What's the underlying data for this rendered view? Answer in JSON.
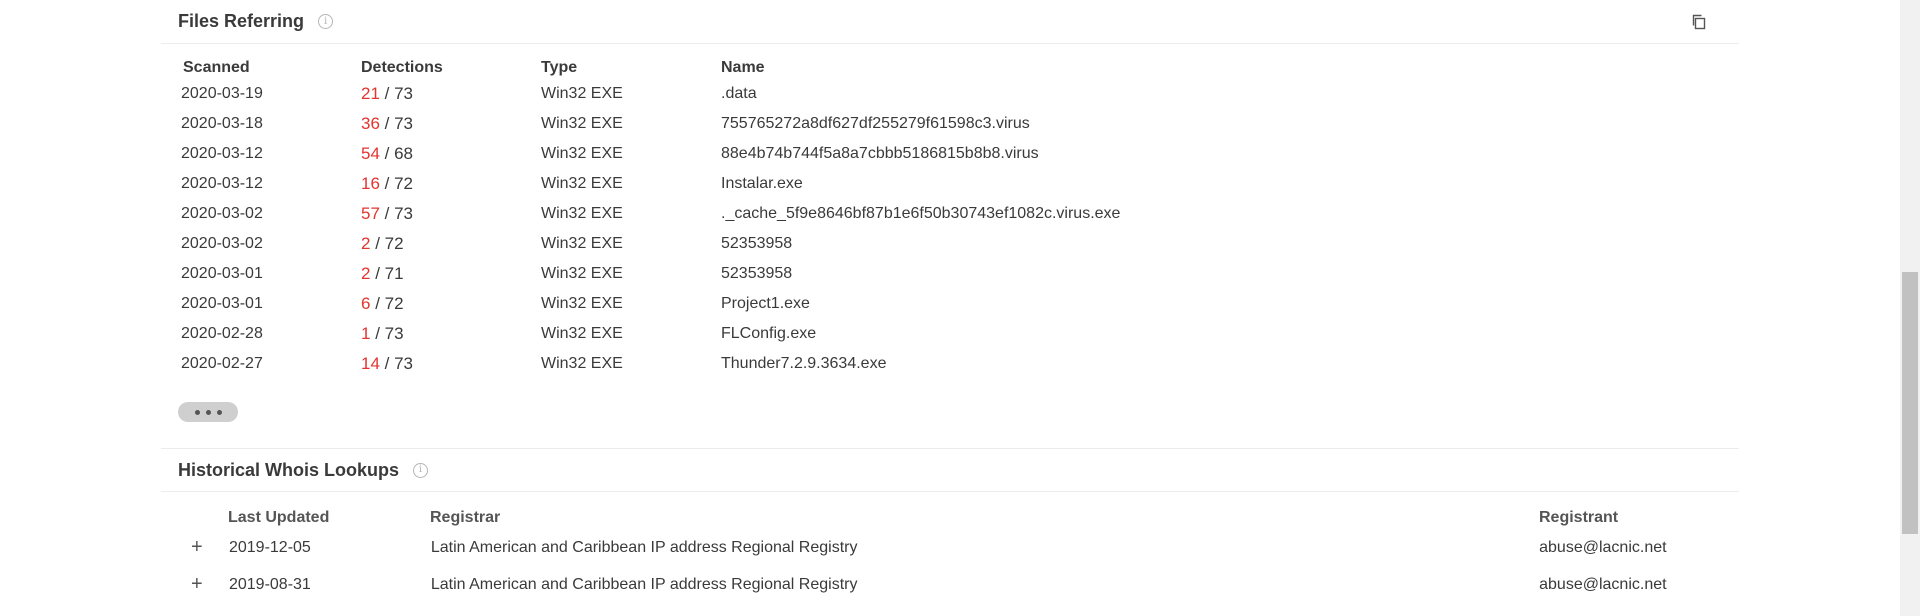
{
  "files_referring": {
    "title": "Files Referring",
    "info_symbol": "i",
    "columns": {
      "scanned": "Scanned",
      "detections": "Detections",
      "type": "Type",
      "name": "Name"
    },
    "rows": [
      {
        "scanned": "2020-03-19",
        "positives": "21",
        "total": " / 73",
        "type": "Win32 EXE",
        "name": ".data"
      },
      {
        "scanned": "2020-03-18",
        "positives": "36",
        "total": " / 73",
        "type": "Win32 EXE",
        "name": "755765272a8df627df255279f61598c3.virus"
      },
      {
        "scanned": "2020-03-12",
        "positives": "54",
        "total": " / 68",
        "type": "Win32 EXE",
        "name": "88e4b74b744f5a8a7cbbb5186815b8b8.virus"
      },
      {
        "scanned": "2020-03-12",
        "positives": "16",
        "total": " / 72",
        "type": "Win32 EXE",
        "name": "Instalar.exe"
      },
      {
        "scanned": "2020-03-02",
        "positives": "57",
        "total": " / 73",
        "type": "Win32 EXE",
        "name": "._cache_5f9e8646bf87b1e6f50b30743ef1082c.virus.exe"
      },
      {
        "scanned": "2020-03-02",
        "positives": "2",
        "total": " / 72",
        "type": "Win32 EXE",
        "name": "52353958"
      },
      {
        "scanned": "2020-03-01",
        "positives": "2",
        "total": " / 71",
        "type": "Win32 EXE",
        "name": "52353958"
      },
      {
        "scanned": "2020-03-01",
        "positives": "6",
        "total": " / 72",
        "type": "Win32 EXE",
        "name": "Project1.exe"
      },
      {
        "scanned": "2020-02-28",
        "positives": "1",
        "total": " / 73",
        "type": "Win32 EXE",
        "name": "FLConfig.exe"
      },
      {
        "scanned": "2020-02-27",
        "positives": "14",
        "total": " / 73",
        "type": "Win32 EXE",
        "name": "Thunder7.2.9.3634.exe"
      }
    ]
  },
  "whois": {
    "title": "Historical Whois Lookups",
    "info_symbol": "i",
    "columns": {
      "last_updated": "Last Updated",
      "registrar": "Registrar",
      "registrant": "Registrant"
    },
    "expand_symbol": "+",
    "rows": [
      {
        "last_updated": "2019-12-05",
        "registrar": "Latin American and Caribbean IP address Regional Registry",
        "registrant": "abuse@lacnic.net"
      },
      {
        "last_updated": "2019-08-31",
        "registrar": "Latin American and Caribbean IP address Regional Registry",
        "registrant": "abuse@lacnic.net"
      }
    ]
  },
  "colors": {
    "detection_positive": "#e3342f",
    "text": "#3a3a3a",
    "divider": "#ececec"
  },
  "icons": {
    "info": "info-icon",
    "copy": "copy-icon",
    "more": "ellipsis-icon",
    "expand": "plus-icon"
  }
}
